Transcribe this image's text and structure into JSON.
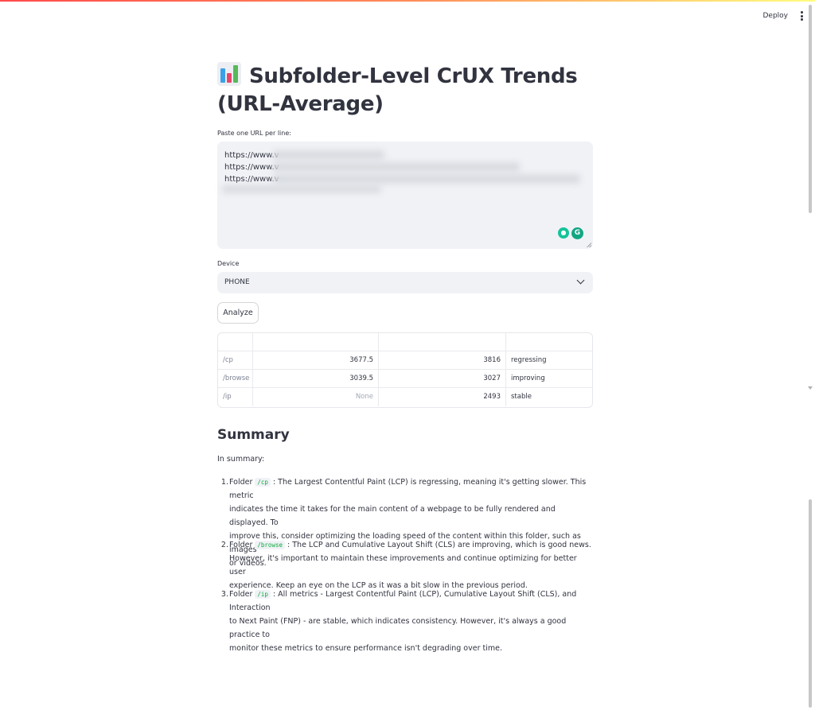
{
  "header": {
    "deploy_label": "Deploy",
    "menu_icon": "kebab-menu-icon"
  },
  "page": {
    "title_icon": "bar-chart-emoji",
    "title_line1": "Subfolder-Level CrUX Trends",
    "title_line2": "(URL-Average)"
  },
  "url_input": {
    "label": "Paste one URL per line:",
    "lines": [
      "https://www.v",
      "https://www.v",
      "https://www.v"
    ]
  },
  "device": {
    "label": "Device",
    "value": "PHONE"
  },
  "analyze": {
    "label": "Analyze"
  },
  "table": {
    "rows": [
      {
        "folder": "/cp",
        "prev": "3677.5",
        "curr": "3816",
        "trend": "regressing"
      },
      {
        "folder": "/browse",
        "prev": "3039.5",
        "curr": "3027",
        "trend": "improving"
      },
      {
        "folder": "/ip",
        "prev": "None",
        "curr": "2493",
        "trend": "stable"
      }
    ]
  },
  "summary": {
    "heading": "Summary",
    "intro": "In summary:",
    "items": [
      {
        "num": "1.",
        "pre": "Folder ",
        "code": "/cp",
        "line1": " : The Largest Contentful Paint (LCP) is regressing, meaning it's getting slower. This metric",
        "line2": "indicates the time it takes for the main content of a webpage to be fully rendered and displayed. To",
        "line3": "improve this, consider optimizing the loading speed of the content within this folder, such as images",
        "line4": "or videos."
      },
      {
        "num": "2.",
        "pre": "Folder ",
        "code": "/browse",
        "line1": " : The LCP and Cumulative Layout Shift (CLS) are improving, which is good news.",
        "line2": "However, it's important to maintain these improvements and continue optimizing for better user",
        "line3": "experience. Keep an eye on the LCP as it was a bit slow in the previous period."
      },
      {
        "num": "3.",
        "pre": "Folder ",
        "code": "/ip",
        "line1": " : All metrics - Largest Contentful Paint (LCP), Cumulative Layout Shift (CLS), and Interaction",
        "line2": "to Next Paint (FNP) - are stable, which indicates consistency. However, it's always a good practice to",
        "line3": "monitor these metrics to ensure performance isn't degrading over time."
      }
    ]
  }
}
